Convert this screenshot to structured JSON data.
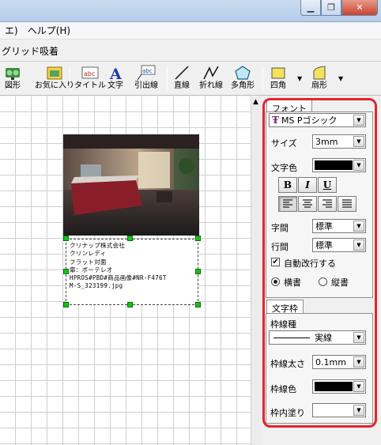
{
  "menu": {
    "items": [
      "エ)",
      "ヘルプ(H)"
    ]
  },
  "options": {
    "grid_snap": "グリッド吸着"
  },
  "toolbar": {
    "buttons": [
      "図形",
      "お気に入り",
      "タイトル",
      "文字",
      "引出線",
      "直線",
      "折れ線",
      "多角形",
      "四角",
      "扇形"
    ]
  },
  "textbox": {
    "lines": [
      "クリナップ株式会社",
      "クリンレディ",
      "フラット対面",
      "扉：ボーテレオ",
      "HPROS#PBD#商品画像#NR-F476T",
      "M-S_323199.jpg"
    ]
  },
  "font_panel": {
    "tab": "フォント",
    "font_name": "MS Pゴシック",
    "size_label": "サイズ",
    "size_value": "3mm",
    "color_label": "文字色",
    "color_value": "#000000",
    "bold": "B",
    "italic": "I",
    "underline": "U",
    "char_spacing_label": "字間",
    "char_spacing_value": "標準",
    "line_spacing_label": "行間",
    "line_spacing_value": "標準",
    "autowrap_label": "自動改行する",
    "autowrap_checked": true,
    "horizontal_label": "横書",
    "vertical_label": "縦書",
    "writing_mode": "horizontal"
  },
  "frame_panel": {
    "tab": "文字枠",
    "line_type_label": "枠線種",
    "line_type_value": "実線",
    "line_width_label": "枠線太さ",
    "line_width_value": "0.1mm",
    "line_color_label": "枠線色",
    "line_color_value": "#000000",
    "fill_label": "枠内塗り",
    "fill_value": "#ffffff"
  },
  "colors": {
    "highlight_frame": "#e0262b",
    "handle": "#1bc11b"
  }
}
